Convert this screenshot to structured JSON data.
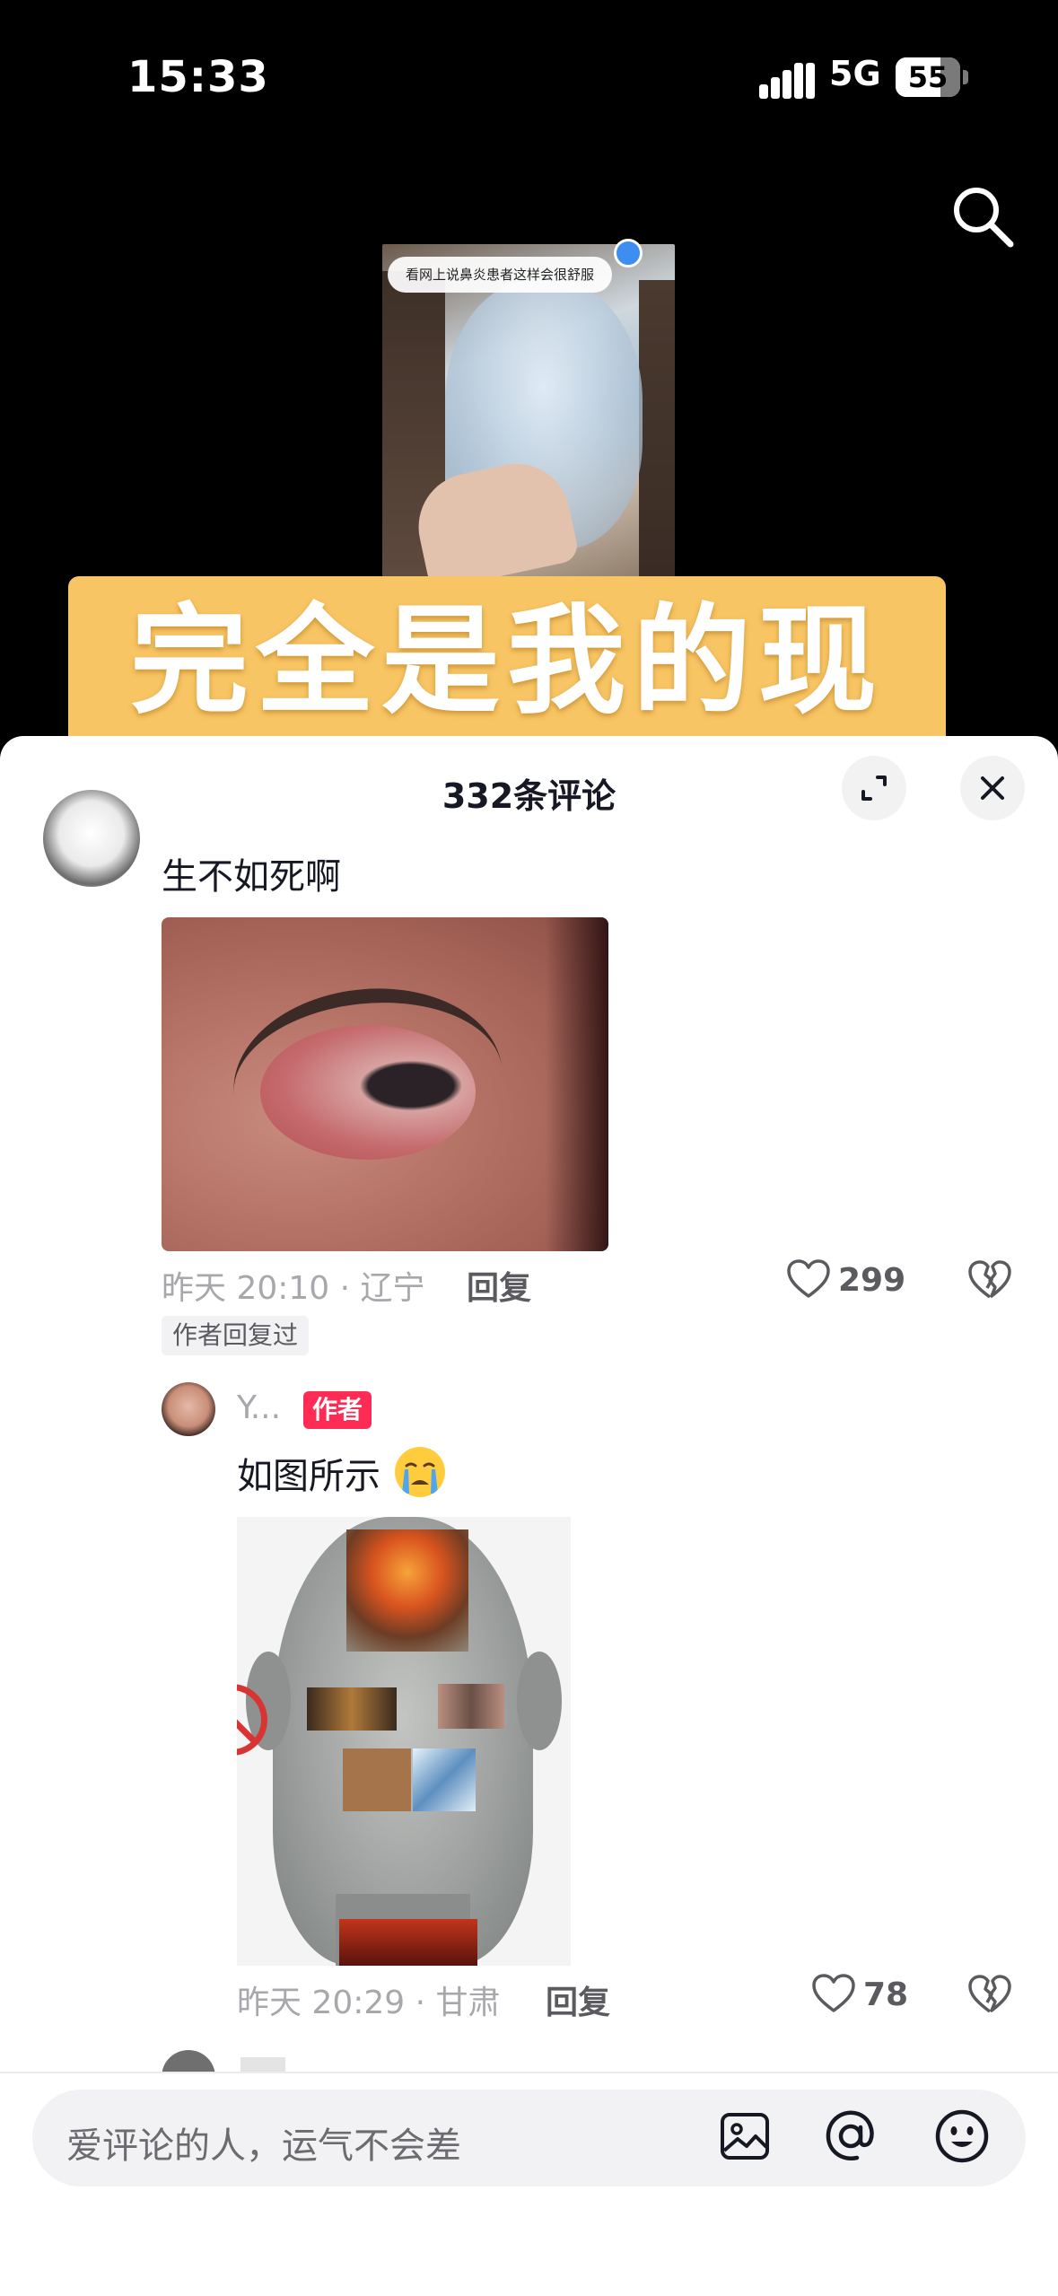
{
  "status_bar": {
    "time": "15:33",
    "network": "5G",
    "battery": "55",
    "battery_level_percent": 55
  },
  "video": {
    "caption": "看网上说鼻炎患者这样会很舒服",
    "overlay_text": "完全是我的现状"
  },
  "comments_sheet": {
    "title": "332条评论",
    "comments": [
      {
        "text": "生不如死啊",
        "meta": "昨天 20:10 · 辽宁",
        "reply_label": "回复",
        "likes": "299",
        "tag": "作者回复过"
      },
      {
        "username": "Y...",
        "badge": "作者",
        "text": "如图所示",
        "emoji": "crying-face",
        "meta": "昨天 20:29 · 甘肃",
        "reply_label": "回复",
        "likes": "78"
      }
    ]
  },
  "input": {
    "placeholder": "爱评论的人，运气不会差"
  },
  "colors": {
    "banner": "#f8c564",
    "author_badge": "#fe2c55",
    "background": "#000000",
    "sheet": "#ffffff"
  }
}
